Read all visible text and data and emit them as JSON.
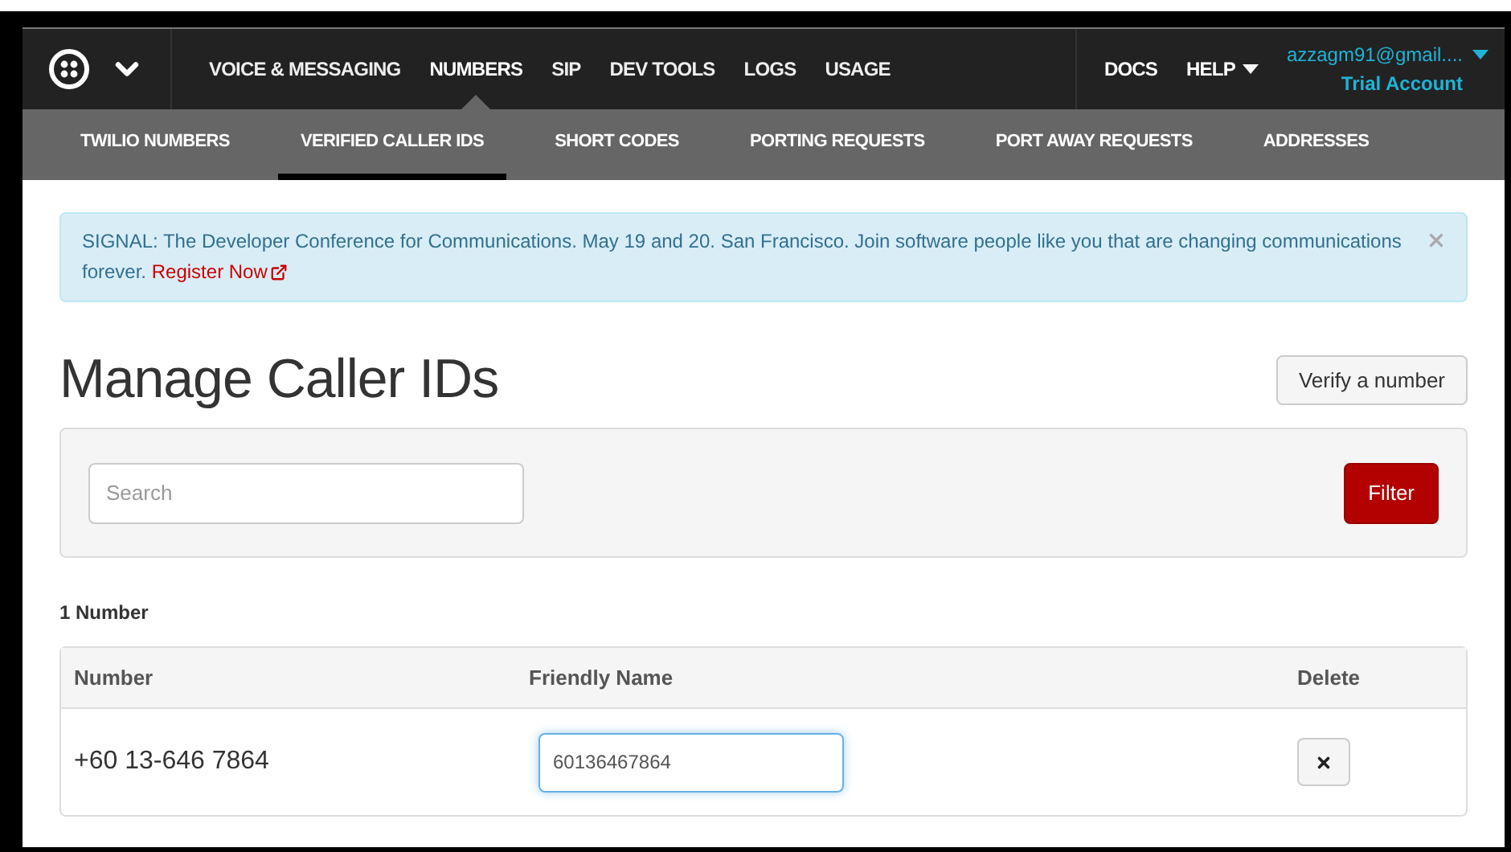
{
  "top_nav": {
    "items": [
      {
        "label": "VOICE & MESSAGING",
        "selected": false
      },
      {
        "label": "NUMBERS",
        "selected": true
      },
      {
        "label": "SIP",
        "selected": false
      },
      {
        "label": "DEV TOOLS",
        "selected": false
      },
      {
        "label": "LOGS",
        "selected": false
      },
      {
        "label": "USAGE",
        "selected": false
      }
    ],
    "right_items": [
      {
        "label": "DOCS",
        "has_menu": false
      },
      {
        "label": "HELP",
        "has_menu": true
      }
    ],
    "account": {
      "email": "azzagm91@gmail....",
      "plan": "Trial Account"
    }
  },
  "sub_nav": [
    {
      "label": "TWILIO NUMBERS",
      "selected": false
    },
    {
      "label": "VERIFIED CALLER IDS",
      "selected": true
    },
    {
      "label": "SHORT CODES",
      "selected": false
    },
    {
      "label": "PORTING REQUESTS",
      "selected": false
    },
    {
      "label": "PORT AWAY REQUESTS",
      "selected": false
    },
    {
      "label": "ADDRESSES",
      "selected": false
    }
  ],
  "alert": {
    "text": "SIGNAL: The Developer Conference for Communications. May 19 and 20. San Francisco. Join software people like you that are changing communications forever.",
    "link": "Register Now"
  },
  "page": {
    "title": "Manage Caller IDs",
    "action": "Verify a number"
  },
  "filter": {
    "search_placeholder": "Search",
    "button": "Filter"
  },
  "count": "1 Number",
  "table": {
    "columns": [
      "Number",
      "Friendly Name",
      "Delete"
    ],
    "rows": [
      {
        "number": "+60 13-646 7864",
        "friendly_name": "60136467864"
      }
    ]
  }
}
